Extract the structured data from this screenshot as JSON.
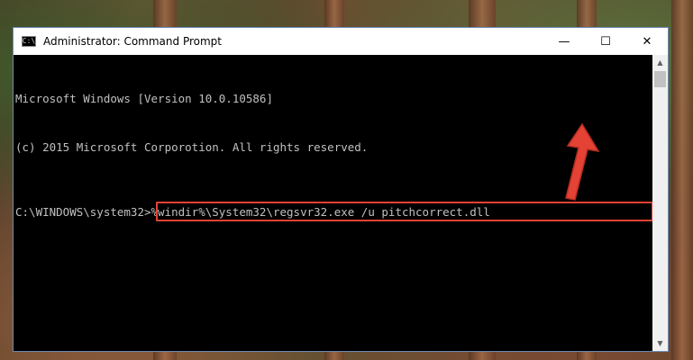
{
  "window": {
    "title": "Administrator: Command Prompt",
    "app_icon_glyph": "C:\\",
    "controls": {
      "minimize": "—",
      "maximize": "☐",
      "close": "✕"
    }
  },
  "console": {
    "lines": [
      "Microsoft Windows [Version 10.0.10586]",
      "(c) 2015 Microsoft Corporotion. All rights reserved."
    ],
    "prompt": "C:\\WINDOWS\\system32>",
    "command": "%windir%\\System32\\regsvr32.exe /u pitchcorrect.dll"
  },
  "scrollbar": {
    "up_arrow": "▲",
    "down_arrow": "▼"
  },
  "colors": {
    "highlight_border": "#e34234",
    "pointer_arrow": "#e34234",
    "console_background": "#000000",
    "console_text": "#c0c0c0"
  }
}
